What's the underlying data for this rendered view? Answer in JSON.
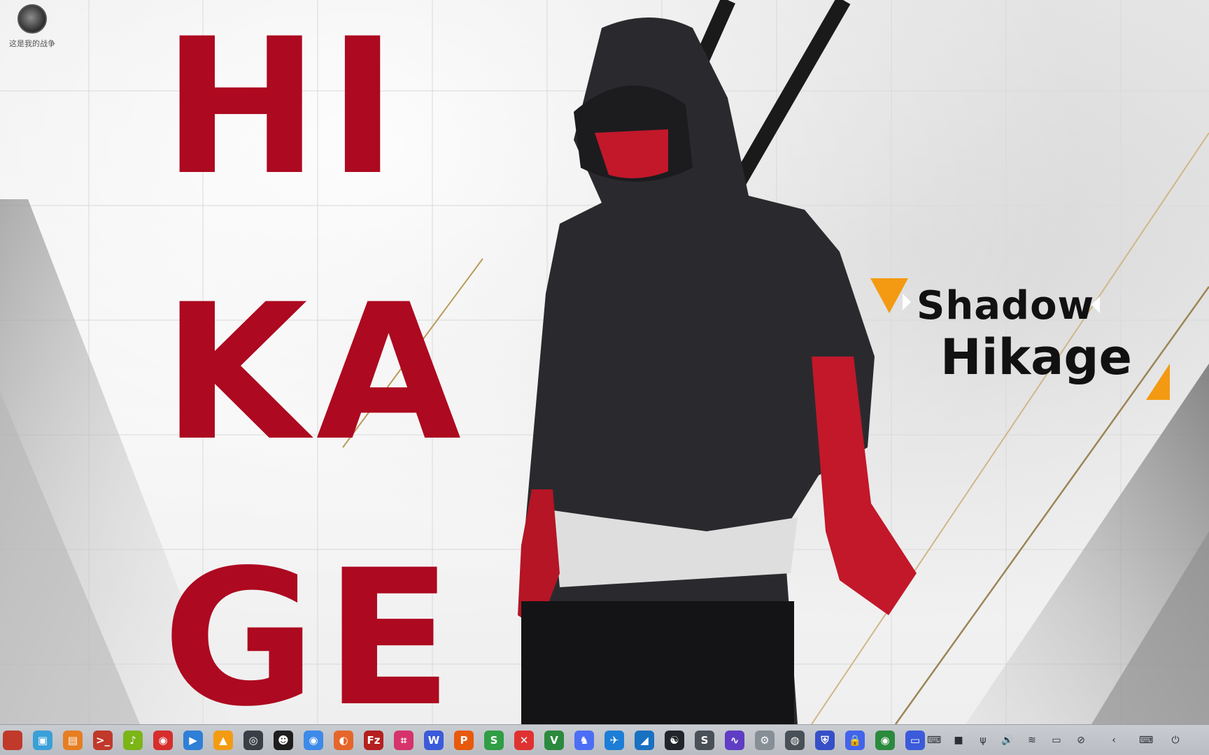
{
  "desktop_icon": {
    "label": "这是我的战争",
    "icon": "tank-game-icon"
  },
  "wallpaper": {
    "big_lines": [
      "HI",
      "KA",
      "GE"
    ],
    "shadow_text": "Shadow",
    "hikage_text": "Hikage",
    "accent_red": "#ad0920",
    "accent_orange": "#f39a12"
  },
  "taskbar": {
    "apps": [
      {
        "name": "app-icon-edge",
        "glyph": "",
        "color": "#c0392b"
      },
      {
        "name": "file-manager-icon",
        "glyph": "▣",
        "color": "#3aa0d8"
      },
      {
        "name": "archive-icon",
        "glyph": "▤",
        "color": "#e67e22"
      },
      {
        "name": "terminal-icon",
        "glyph": ">_",
        "color": "#c0392b"
      },
      {
        "name": "music-player-icon",
        "glyph": "♪",
        "color": "#7cb518"
      },
      {
        "name": "netease-music-icon",
        "glyph": "◉",
        "color": "#d62d2d"
      },
      {
        "name": "video-player-icon",
        "glyph": "▶",
        "color": "#2f7fd6"
      },
      {
        "name": "vlc-icon",
        "glyph": "▲",
        "color": "#f39c12"
      },
      {
        "name": "steam-icon",
        "glyph": "◎",
        "color": "#3a3f47"
      },
      {
        "name": "qq-icon",
        "glyph": "☻",
        "color": "#1e1e1e"
      },
      {
        "name": "chrome-icon",
        "glyph": "◉",
        "color": "#3d8ae8"
      },
      {
        "name": "firefox-icon",
        "glyph": "◐",
        "color": "#e5662b"
      },
      {
        "name": "filezilla-icon",
        "glyph": "Fz",
        "color": "#b51f1f"
      },
      {
        "name": "screenshot-icon",
        "glyph": "⌗",
        "color": "#d6336c"
      },
      {
        "name": "wps-writer-icon",
        "glyph": "W",
        "color": "#3b5bdb"
      },
      {
        "name": "wps-presentation-icon",
        "glyph": "P",
        "color": "#e8590c"
      },
      {
        "name": "wps-spreadsheet-icon",
        "glyph": "S",
        "color": "#2f9e44"
      },
      {
        "name": "xmind-icon",
        "glyph": "✕",
        "color": "#e03131"
      },
      {
        "name": "vim-icon",
        "glyph": "V",
        "color": "#2b8a3e"
      },
      {
        "name": "bird-app-icon",
        "glyph": "♞",
        "color": "#4c6ef5"
      },
      {
        "name": "feishu-icon",
        "glyph": "✈",
        "color": "#1c7ed6"
      },
      {
        "name": "shark-app-icon",
        "glyph": "◢",
        "color": "#1971c2"
      },
      {
        "name": "yin-yang-icon",
        "glyph": "☯",
        "color": "#212529"
      },
      {
        "name": "sublime-text-icon",
        "glyph": "S",
        "color": "#495057"
      },
      {
        "name": "system-monitor-icon",
        "glyph": "∿",
        "color": "#5f3dc4"
      },
      {
        "name": "settings-gear-icon",
        "glyph": "⚙",
        "color": "#868e96"
      },
      {
        "name": "disk-utility-icon",
        "glyph": "◍",
        "color": "#495057"
      },
      {
        "name": "shield-icon",
        "glyph": "⛨",
        "color": "#364fc7"
      },
      {
        "name": "lock-icon",
        "glyph": "🔒",
        "color": "#4263eb"
      },
      {
        "name": "webcam-app-icon",
        "glyph": "◉",
        "color": "#2b8a3e"
      },
      {
        "name": "window-thumbnail-icon",
        "glyph": "▭",
        "color": "#3b5bdb"
      }
    ],
    "tray": [
      {
        "name": "keyboard-icon",
        "glyph": "⌨"
      },
      {
        "name": "camera-icon",
        "glyph": "■"
      },
      {
        "name": "usb-icon",
        "glyph": "ψ"
      },
      {
        "name": "volume-icon",
        "glyph": "🔊"
      },
      {
        "name": "wifi-icon",
        "glyph": "≋"
      },
      {
        "name": "battery-icon",
        "glyph": "▭"
      },
      {
        "name": "compass-icon",
        "glyph": "⊘"
      },
      {
        "name": "chevron-left-icon",
        "glyph": "‹"
      },
      {
        "name": "onscreen-keyboard-icon",
        "glyph": "⌨"
      },
      {
        "name": "power-icon",
        "glyph": "⏻"
      }
    ]
  }
}
